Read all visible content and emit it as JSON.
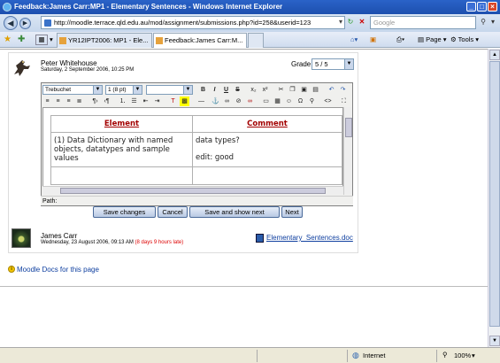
{
  "window": {
    "title": "Feedback:James Carr:MP1 - Elementary Sentences - Windows Internet Explorer"
  },
  "addressbar": {
    "url": "http://moodle.terrace.qld.edu.au/mod/assignment/submissions.php?id=258&userid=123",
    "search_placeholder": "Google"
  },
  "tabs": [
    {
      "label": "YR12IPT2006: MP1 - Ele..."
    },
    {
      "label": "Feedback:James Carr:M..."
    }
  ],
  "toolbar": {
    "page_label": "Page",
    "tools_label": "Tools"
  },
  "feedback": {
    "teacher_name": "Peter Whitehouse",
    "teacher_date": "Saturday, 2 September 2006, 10:25 PM",
    "grade_label": "Grade:",
    "grade_value": "5 / 5"
  },
  "editor": {
    "font_name": "Trebuchet",
    "font_size": "1 (8 pt)",
    "table_headers": [
      "Element",
      "Comment"
    ],
    "row1_element": "(1) Data Dictionary with named objects, datatypes and sample values",
    "row1_comment_a": "data types?",
    "row1_comment_b": "edit: good",
    "path_label": "Path:"
  },
  "buttons": {
    "save_changes": "Save changes",
    "cancel": "Cancel",
    "save_next": "Save and show next",
    "next": "Next"
  },
  "submission": {
    "student_name": "James Carr",
    "student_date": "Wednesday, 23 August 2006, 09:13 AM",
    "late_note": "(8 days 9 hours late)",
    "file_name": "Elementary_Sentences.doc"
  },
  "footer_link": "Moodle Docs for this page",
  "statusbar": {
    "zone": "Internet",
    "zoom": "100%"
  }
}
